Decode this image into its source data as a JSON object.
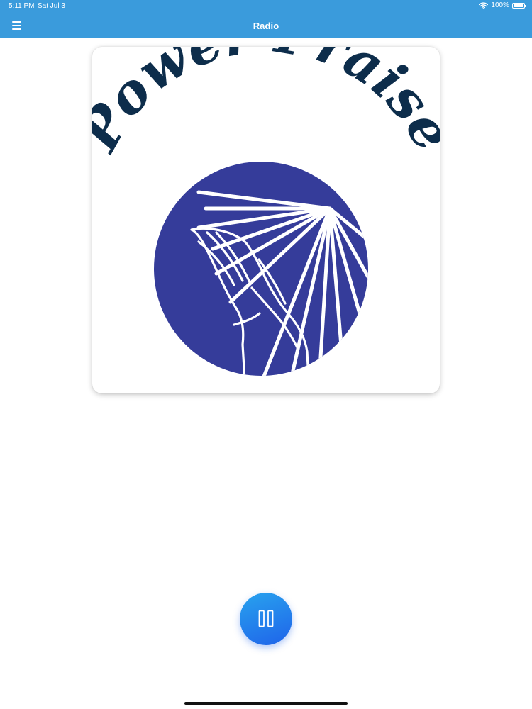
{
  "status_bar": {
    "time": "5:11 PM",
    "date": "Sat Jul 3",
    "battery_percent": "100%",
    "battery_level": 1.0,
    "icons": [
      "wifi-icon",
      "battery-icon"
    ]
  },
  "nav": {
    "title": "Radio",
    "menu_icon": "hamburger-menu-icon",
    "bar_color": "#3a9bdc"
  },
  "station": {
    "logo_text": "Power Praise",
    "logo_text_color": "#0d2d4b",
    "logo_circle_color": "#353c9a"
  },
  "player": {
    "state": "playing",
    "control_icon": "pause-icon",
    "button_color_top": "#28a3ee",
    "button_color_bottom": "#1f63ea"
  }
}
